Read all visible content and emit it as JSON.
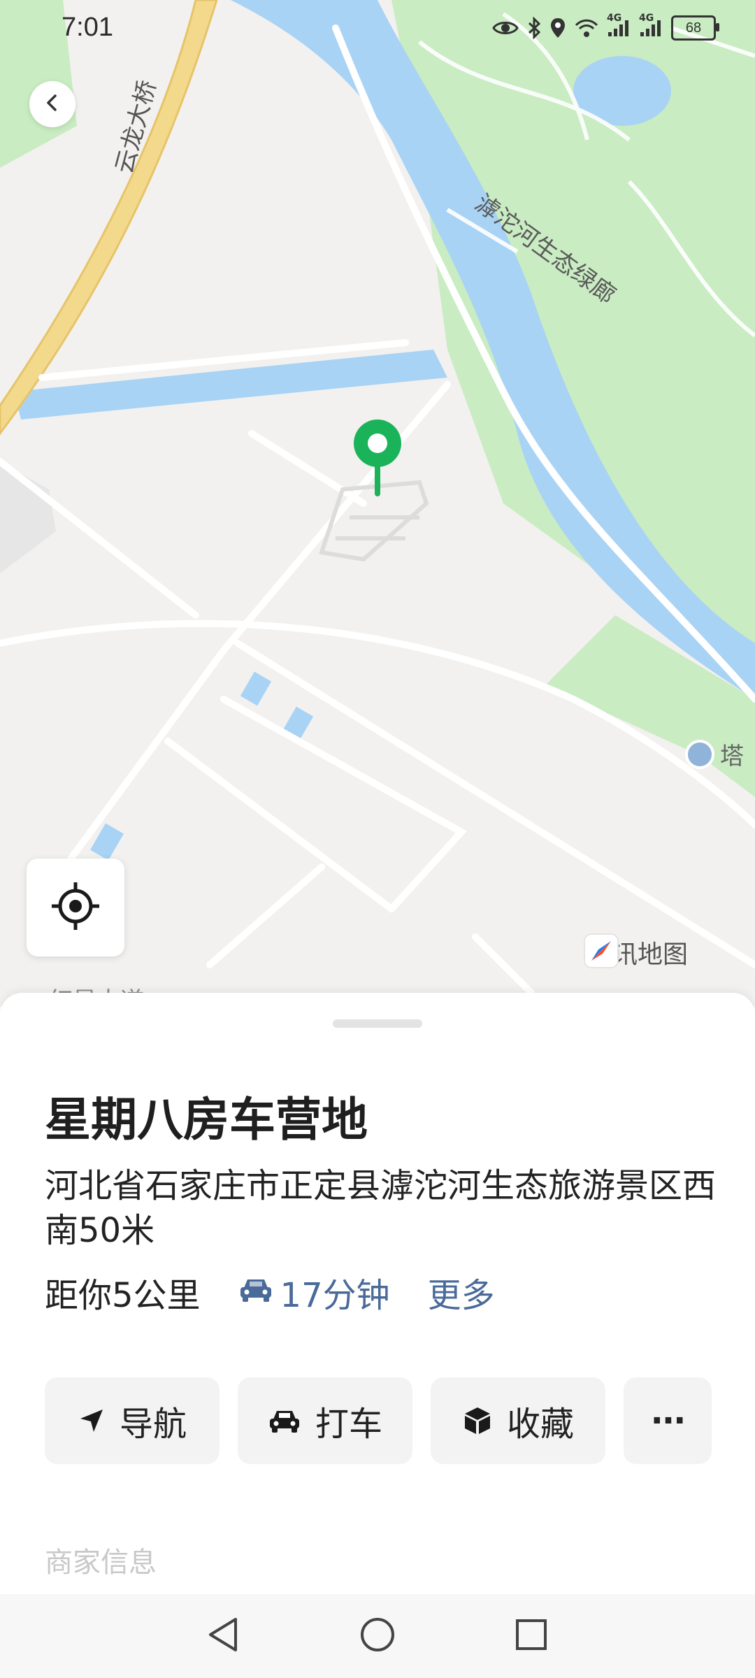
{
  "status_bar": {
    "time": "7:01",
    "battery": "68",
    "network_labels": [
      "4G",
      "4G"
    ]
  },
  "map": {
    "labels": {
      "bridge": "云龙大桥",
      "greenway": "滹沱河生态绿廊",
      "poi_partial": "塔",
      "road_partial": "红星大道"
    },
    "provider": "腾讯地图",
    "colors": {
      "land": "#f2f1ef",
      "water": "#a8d3f5",
      "park": "#c9ecc2",
      "highway": "#f3d98c",
      "pin": "#1ab35a"
    }
  },
  "place": {
    "name": "星期八房车营地",
    "address": "河北省石家庄市正定县滹沱河生态旅游景区西南50米",
    "distance": "距你5公里",
    "drive_time": "17分钟",
    "more_label": "更多"
  },
  "actions": {
    "navigate": "导航",
    "taxi": "打车",
    "favorite": "收藏",
    "more": "···"
  },
  "section_label": "商家信息",
  "icons": {
    "back": "chevron-left-icon",
    "locate": "locate-icon",
    "navigate": "navigation-arrow-icon",
    "taxi": "car-icon",
    "favorite": "box-icon",
    "nav_back": "triangle-back-icon",
    "nav_home": "circle-home-icon",
    "nav_recent": "square-recent-icon"
  }
}
